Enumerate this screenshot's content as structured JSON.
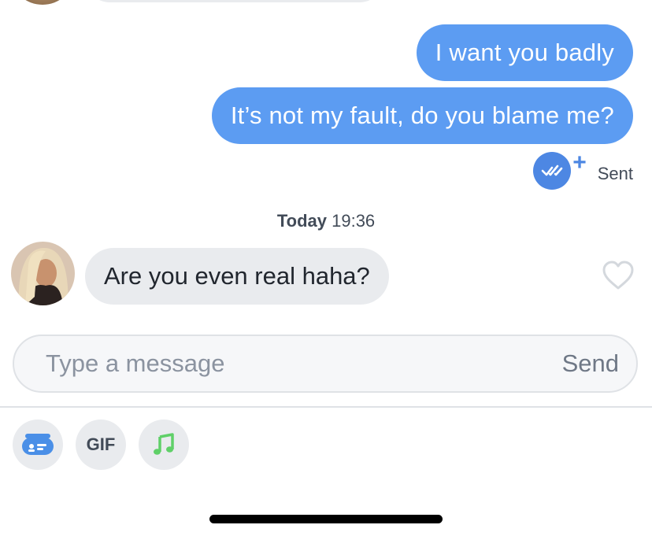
{
  "messages_out": [
    {
      "text": "I want you badly"
    },
    {
      "text": "It’s not my fault, do you blame me?"
    }
  ],
  "receipt": {
    "status": "Sent",
    "icon": "read-receipt-icon",
    "color": "#4d87e3"
  },
  "timestamp": {
    "day": "Today",
    "time": "19:36"
  },
  "message_in": {
    "text": "Are you even real haha?"
  },
  "composer": {
    "placeholder": "Type a message",
    "send_label": "Send"
  },
  "toolbar": {
    "gif_label": "GIF"
  },
  "colors": {
    "outgoing_bubble": "#5c9cf2",
    "incoming_bubble": "#e9ebee",
    "music_green": "#5fd068",
    "card_blue": "#4a8fe7"
  }
}
